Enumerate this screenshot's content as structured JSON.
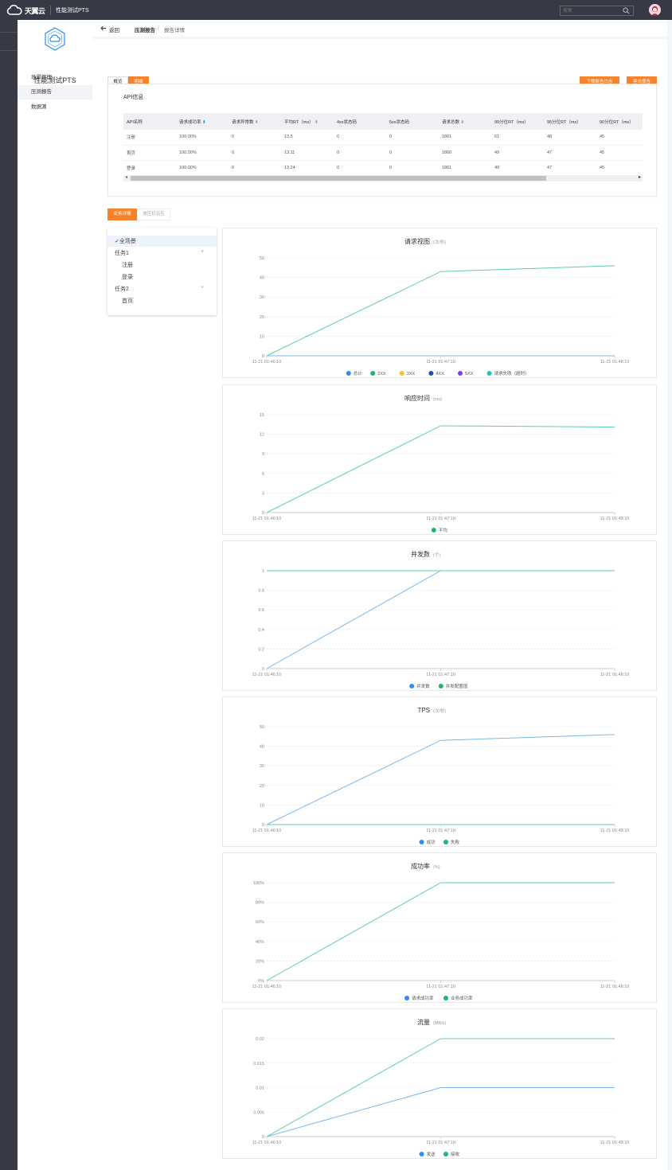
{
  "header": {
    "logo_text": "天翼云",
    "logo_subtext": "e Cloud",
    "product": "性能测试PTS",
    "search_placeholder": "搜索"
  },
  "sidebar": {
    "title": "性能测试PTS",
    "items": [
      {
        "label": "场景管理",
        "active": false
      },
      {
        "label": "压测报告",
        "active": true
      },
      {
        "label": "数据源",
        "active": false
      }
    ]
  },
  "breadcrumb": {
    "back": "返回",
    "section": "压测报告",
    "sep": "/",
    "current": "报告详情"
  },
  "view_tabs": [
    {
      "label": "概览",
      "active": false
    },
    {
      "label": "明细",
      "active": true
    }
  ],
  "actions": {
    "download": "下载新告日志",
    "export": "导出报告"
  },
  "api_info": {
    "title": "API信息",
    "columns": [
      "API名称",
      "请求成功率",
      "请求异常数",
      "平均RT（ms）",
      "4xx状态码",
      "5xx状态码",
      "请求总数",
      "99分位RT（ms）",
      "95分位RT（ms）",
      "90分位RT（ms）"
    ],
    "rows": [
      [
        "注册",
        "100.00%",
        "0",
        "13.5",
        "0",
        "0",
        "1861",
        "61",
        "48",
        "45"
      ],
      [
        "首页",
        "100.00%",
        "0",
        "13.11",
        "0",
        "0",
        "1860",
        "49",
        "47",
        "45"
      ],
      [
        "登录",
        "100.00%",
        "0",
        "13.24",
        "0",
        "0",
        "1861",
        "49",
        "47",
        "45"
      ]
    ]
  },
  "detail_tabs": [
    {
      "label": "业务详情",
      "active": true
    },
    {
      "label": "施压机监控",
      "active": false
    }
  ],
  "tree": [
    {
      "label": "✓全场景",
      "level": 0,
      "selected": true
    },
    {
      "label": "任务1",
      "level": 0,
      "expandable": true
    },
    {
      "label": "注册",
      "level": 1
    },
    {
      "label": "登录",
      "level": 1
    },
    {
      "label": "任务2",
      "level": 0,
      "expandable": true
    },
    {
      "label": "首页",
      "level": 1
    }
  ],
  "colors": {
    "accent": "#f5832d",
    "blue": "#2b8ef3",
    "green": "#23b36b",
    "yellow": "#f7c02e",
    "darkblue": "#1f4fa8",
    "purple": "#7b3fe4",
    "cyan": "#25c0c0",
    "line_green": "#5fcf9f",
    "line_blue": "#7ab8ef"
  },
  "chart_data": [
    {
      "type": "line",
      "title": "请求视图",
      "unit": "(次/秒)",
      "x": [
        "11-21 01:46:10",
        "11-21 01:47:10",
        "11-21 01:48:10"
      ],
      "ylim": [
        0,
        50
      ],
      "yticks": [
        "0",
        "10",
        "20",
        "30",
        "40",
        "50"
      ],
      "series": [
        {
          "name": "总计",
          "color": "#2b8ef3",
          "values": [
            0,
            0,
            0
          ],
          "hidden": true
        },
        {
          "name": "2XX",
          "color": "#23b36b",
          "values": [
            0,
            43,
            46
          ]
        },
        {
          "name": "3XX",
          "color": "#f7c02e",
          "values": [
            0,
            0,
            0
          ],
          "hidden": true
        },
        {
          "name": "4XX",
          "color": "#1f4fa8",
          "values": [
            0,
            0,
            0
          ],
          "hidden": true
        },
        {
          "name": "5XX",
          "color": "#7b3fe4",
          "values": [
            0,
            0,
            0
          ],
          "hidden": true
        },
        {
          "name": "请求失败（超时）",
          "color": "#25c0c0",
          "values": [
            0,
            0,
            0
          ]
        }
      ]
    },
    {
      "type": "line",
      "title": "响应时间",
      "unit": "(ms)",
      "x": [
        "11-21 01:46:10",
        "11-21 01:47:10",
        "11-21 01:48:10"
      ],
      "ylim": [
        0,
        15
      ],
      "yticks": [
        "0",
        "3",
        "6",
        "9",
        "12",
        "15"
      ],
      "series": [
        {
          "name": "平均",
          "color": "#23b36b",
          "values": [
            0,
            13.3,
            13.1
          ]
        }
      ]
    },
    {
      "type": "line",
      "title": "并发数",
      "unit": "(个)",
      "x": [
        "11-21 01:46:10",
        "11-21 01:47:10",
        "11-21 01:48:10"
      ],
      "ylim": [
        0,
        1
      ],
      "yticks": [
        "0",
        "0.2",
        "0.4",
        "0.6",
        "0.8",
        "1"
      ],
      "series": [
        {
          "name": "并发数",
          "color": "#2b8ef3",
          "values": [
            0,
            1,
            1
          ]
        },
        {
          "name": "并发配置值",
          "color": "#23b36b",
          "values": [
            1,
            1,
            1
          ]
        }
      ]
    },
    {
      "type": "line",
      "title": "TPS",
      "unit": "(次/秒)",
      "x": [
        "11-21 01:46:10",
        "11-21 01:47:10",
        "11-21 01:48:10"
      ],
      "ylim": [
        0,
        50
      ],
      "yticks": [
        "0",
        "10",
        "20",
        "30",
        "40",
        "50"
      ],
      "series": [
        {
          "name": "成功",
          "color": "#2b8ef3",
          "values": [
            0,
            43,
            46
          ]
        },
        {
          "name": "失败",
          "color": "#23b36b",
          "values": [
            0,
            0,
            0
          ]
        }
      ]
    },
    {
      "type": "line",
      "title": "成功率",
      "unit": "(%)",
      "x": [
        "11-21 01:46:10",
        "11-21 01:47:10",
        "11-21 01:48:10"
      ],
      "ylim": [
        0,
        100
      ],
      "yticks": [
        "0%",
        "20%",
        "40%",
        "60%",
        "80%",
        "100%"
      ],
      "series": [
        {
          "name": "请求成功率",
          "color": "#2b8ef3",
          "values": [
            0,
            100,
            100
          ],
          "hidden": true
        },
        {
          "name": "业务成功率",
          "color": "#23b36b",
          "values": [
            0,
            100,
            100
          ]
        }
      ]
    },
    {
      "type": "line",
      "title": "流量",
      "unit": "(MB/s)",
      "x": [
        "11-21 01:46:10",
        "11-21 01:47:10",
        "11-21 01:48:10"
      ],
      "ylim": [
        0,
        0.02
      ],
      "yticks": [
        "0",
        "0.005",
        "0.01",
        "0.015",
        "0.02"
      ],
      "series": [
        {
          "name": "发送",
          "color": "#2b8ef3",
          "values": [
            0,
            0.01,
            0.01
          ]
        },
        {
          "name": "接收",
          "color": "#23b36b",
          "values": [
            0,
            0.02,
            0.02
          ]
        }
      ]
    }
  ]
}
